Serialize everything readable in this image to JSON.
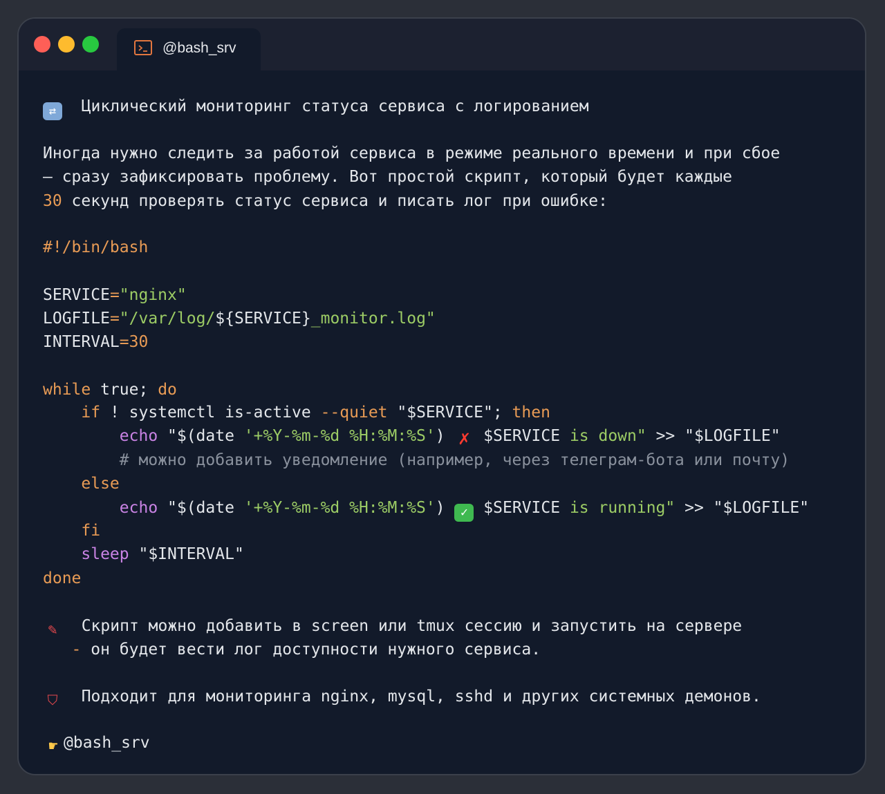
{
  "window": {
    "tab_title": "@bash_srv"
  },
  "post": {
    "heading": "Циклический мониторинг статуса сервиса с логированием",
    "intro_line1": "Иногда нужно следить за работой сервиса в режиме реального времени и при сбое",
    "intro_line2": "— сразу зафиксировать проблему. Вот простой скрипт, который будет каждые",
    "intro_line3_num": "30",
    "intro_line3_rest": " секунд проверять статус сервиса и писать лог при ошибке:",
    "code": {
      "shebang": "#!/bin/bash",
      "service_var": "SERVICE",
      "service_val": "\"nginx\"",
      "logfile_var": "LOGFILE",
      "logfile_q1": "\"/var/log/",
      "logfile_mid": "${SERVICE}",
      "logfile_q2": "_monitor.log\"",
      "interval_var": "INTERVAL",
      "interval_val": "30",
      "while": "while",
      "true": " true; ",
      "do": "do",
      "if": "if",
      "not": " ! systemctl is-active ",
      "quiet": "--quiet",
      "svc_q": " \"$SERVICE\"; ",
      "then": "then",
      "echo": "echo",
      "date_open": " \"$(date ",
      "date_fmt": "'+%Y-%m-%d %H:%M:%S'",
      "date_close": ") ",
      "svc_name": " $SERVICE ",
      "down_text": "is down\"",
      "redir": " >> ",
      "logfile_ref": "\"$LOGFILE\"",
      "comment": "# можно добавить уведомление (например, через телеграм-бота или почту)",
      "else": "else",
      "running_text": "is running\"",
      "fi": "fi",
      "sleep": "sleep",
      "sleep_arg": " \"$INTERVAL\"",
      "done": "done"
    },
    "note1_line1": "Скрипт можно добавить в screen или tmux сессию и запустить на сервере",
    "note1_dash": "-",
    "note1_line2": " он будет вести лог доступности нужного сервиса.",
    "note2": "Подходит для мониторинга nginx, mysql, sshd и других системных демонов.",
    "signature": "@bash_srv"
  },
  "colors": {
    "background": "#121a2a",
    "keyword": "#e89b55",
    "string": "#9ccc65",
    "builtin": "#c983e4",
    "comment": "#8a919d"
  }
}
